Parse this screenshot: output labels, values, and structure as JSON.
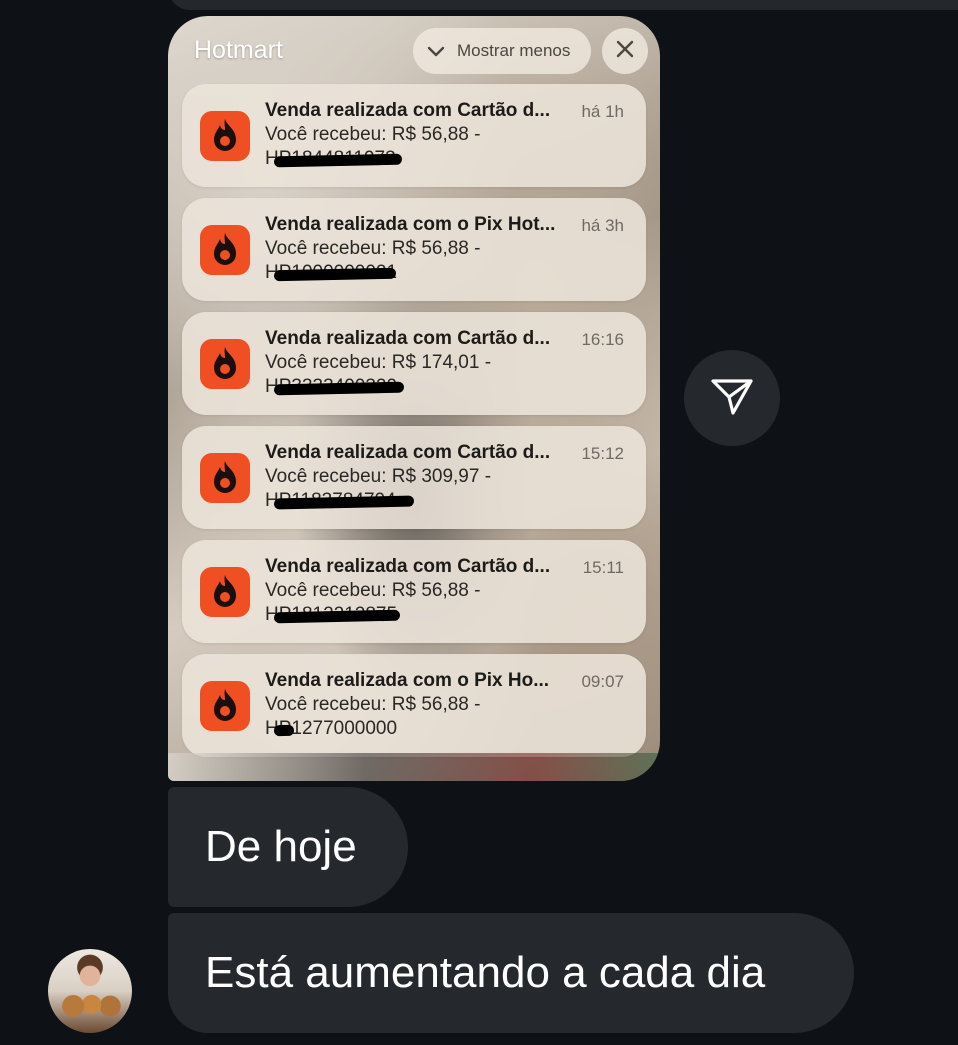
{
  "card": {
    "app_name": "Hotmart",
    "show_less_label": "Mostrar menos",
    "notifications": [
      {
        "title": "Venda realizada com Cartão d...",
        "time": "há 1h",
        "body": "Você recebeu: R$ 56,88 -",
        "code": "HP1844811973"
      },
      {
        "title": "Venda realizada com o Pix Hot...",
        "time": "há 3h",
        "body": "Você recebeu: R$ 56,88 -",
        "code": "HP1000000021"
      },
      {
        "title": "Venda realizada com Cartão d...",
        "time": "16:16",
        "body": "Você recebeu: R$ 174,01 -",
        "code": "HP3333400329"
      },
      {
        "title": "Venda realizada com Cartão d...",
        "time": "15:12",
        "body": "Você recebeu: R$ 309,97 -",
        "code": "HP1183784704"
      },
      {
        "title": "Venda realizada com Cartão d...",
        "time": "15:11",
        "body": "Você recebeu: R$ 56,88 -",
        "code": "HP1812212875"
      },
      {
        "title": "Venda realizada com o Pix Ho...",
        "time": "09:07",
        "body": "Você recebeu: R$ 56,88 -",
        "code": "HP1277000000"
      }
    ]
  },
  "messages": [
    {
      "text": "De hoje"
    },
    {
      "text": "Está aumentando a cada dia"
    }
  ],
  "icons": {
    "app": "hotmart-flame-icon",
    "share": "send-icon",
    "close": "close-icon",
    "chevron": "chevron-down-icon"
  },
  "colors": {
    "background": "#0e1116",
    "bubble": "#25282d",
    "hotmart_orange": "#f04e23"
  }
}
